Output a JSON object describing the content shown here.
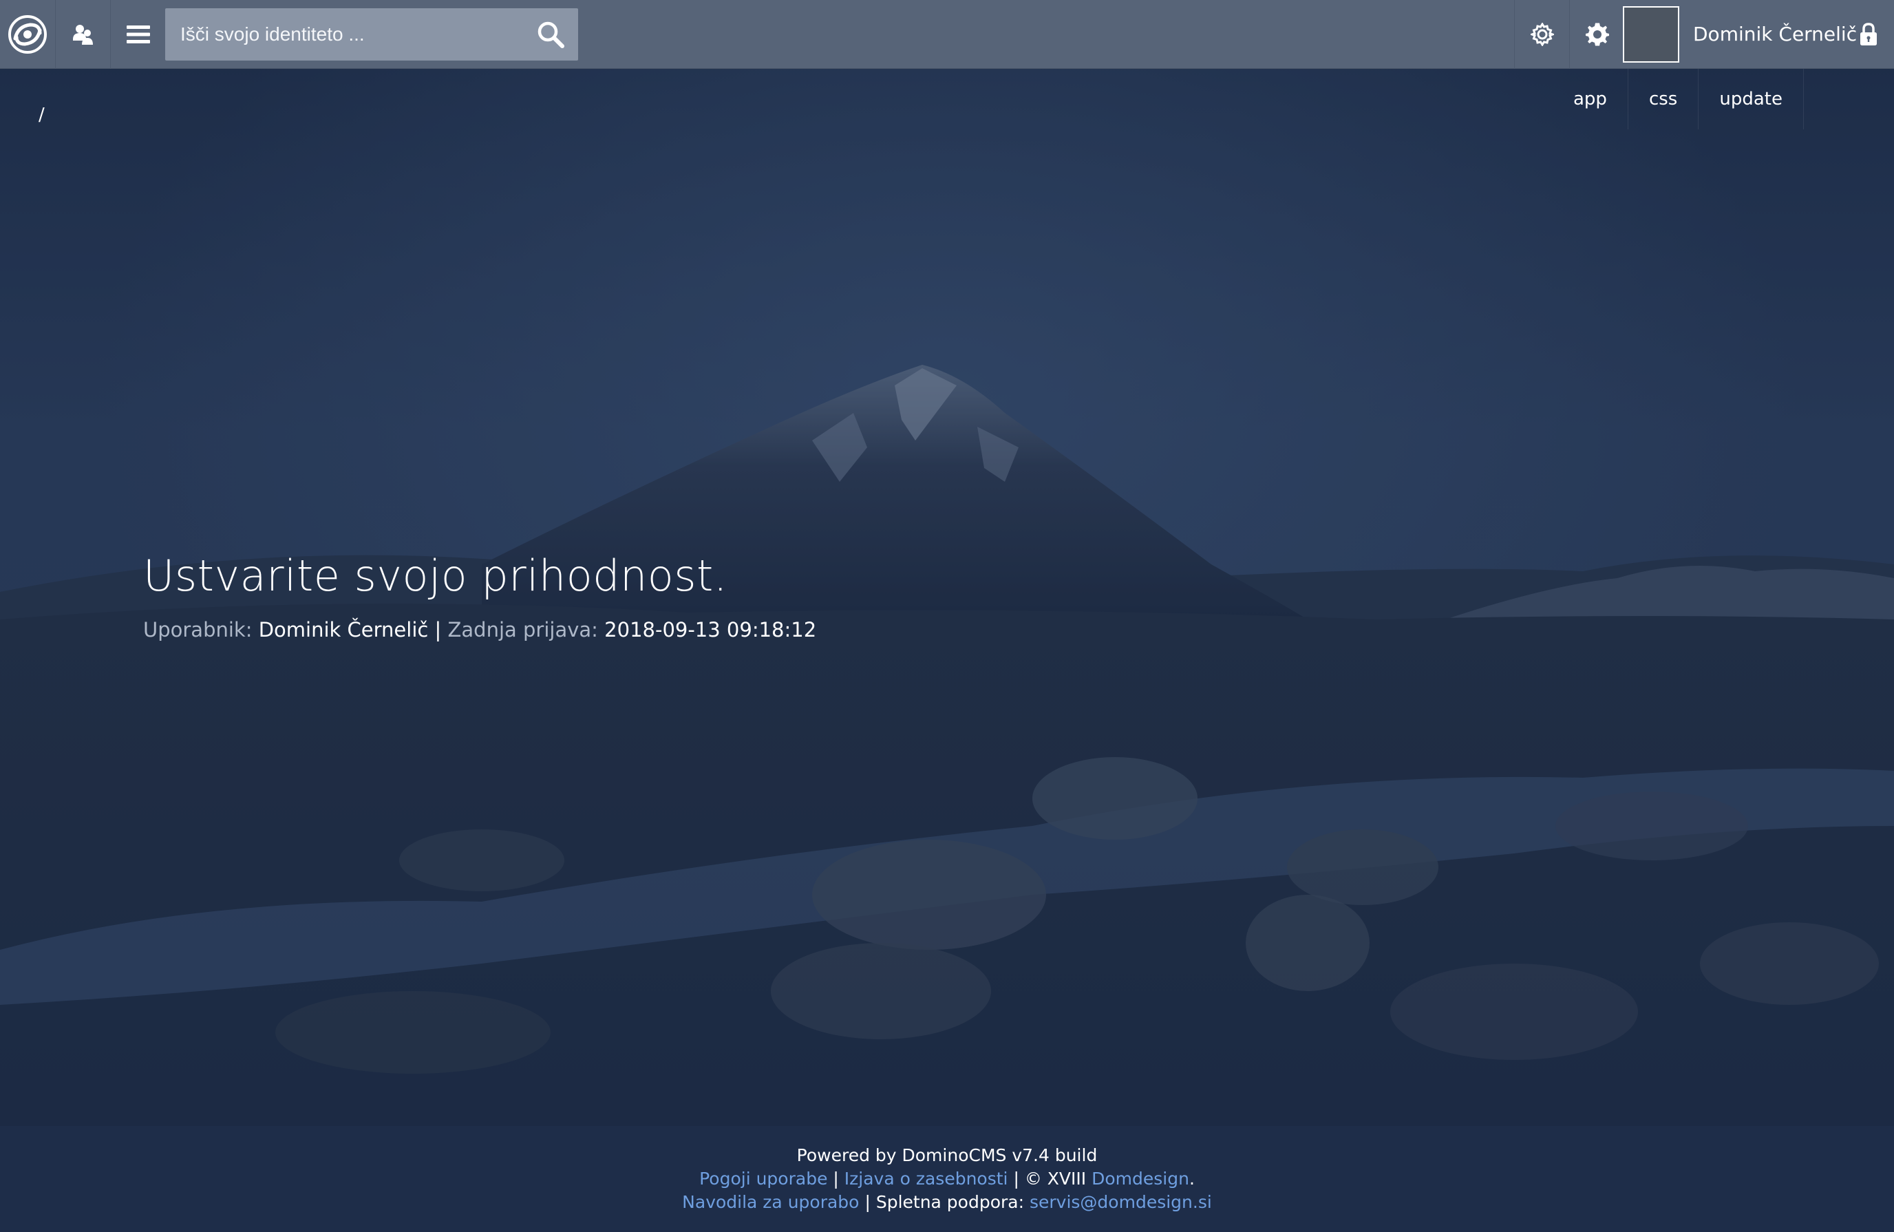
{
  "header": {
    "search_placeholder": "Išči svojo identiteto ...",
    "username": "Dominik Černelič",
    "icons": [
      "swirl-logo-icon",
      "users-icon",
      "hamburger-menu-icon",
      "search-icon",
      "gear-icon",
      "settings-cog-icon",
      "lock-icon"
    ]
  },
  "subnav": {
    "items": [
      {
        "label": "app"
      },
      {
        "label": "css"
      },
      {
        "label": "update"
      }
    ]
  },
  "breadcrumb": "/",
  "hero": {
    "title": "Ustvarite svojo prihodnost.",
    "user_label": "Uporabnik:",
    "user_value": "Dominik Černelič",
    "separator": "|",
    "last_login_label": "Zadnja prijava:",
    "last_login_value": "2018-09-13 09:18:12"
  },
  "footer": {
    "powered": "Powered by DominoCMS v7.4 build",
    "terms": "Pogoji uporabe",
    "privacy": "Izjava o zasebnosti",
    "copyright": "© XVIII",
    "company": "Domdesign",
    "period": ".",
    "manual": "Navodila za uporabo",
    "support_label": "Spletna podpora:",
    "support_email": "servis@domdesign.si",
    "pipe": "|"
  },
  "colors": {
    "topbar": "#576478",
    "footer": "#1e2d49",
    "link": "#6f9fe0",
    "overlay": "#1b2a45"
  }
}
